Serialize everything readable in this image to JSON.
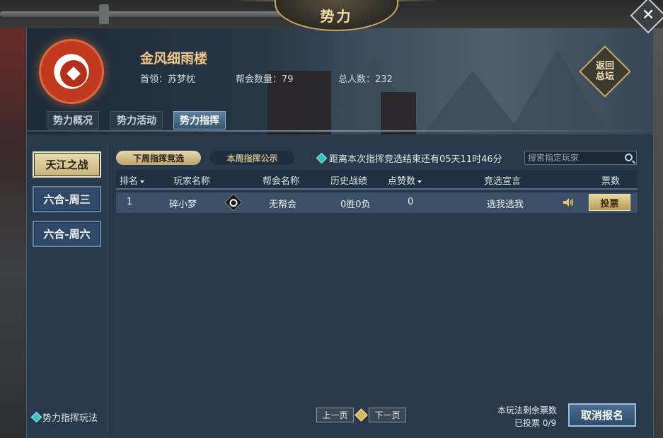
{
  "window": {
    "title": "势力",
    "close_glyph": "✕"
  },
  "faction": {
    "name": "金风细雨楼",
    "leader_label": "首领：苏梦枕",
    "guild_count_label": "帮会数量：79",
    "total_members_label": "总人数：232",
    "return_button": "返回总坛"
  },
  "main_tabs": [
    {
      "label": "势力概况",
      "active": false
    },
    {
      "label": "势力活动",
      "active": false
    },
    {
      "label": "势力指挥",
      "active": true
    }
  ],
  "sidebar": {
    "items": [
      {
        "label": "天江之战",
        "active": true
      },
      {
        "label": "六合-周三",
        "active": false
      },
      {
        "label": "六合-周六",
        "active": false
      }
    ],
    "rules_link": "势力指挥玩法"
  },
  "sub_tabs": [
    {
      "label": "下周指挥竞选",
      "active": true
    },
    {
      "label": "本周指挥公示",
      "active": false
    }
  ],
  "countdown_text": "距离本次指挥竞选结束还有05天11时46分",
  "search": {
    "placeholder": "搜索指定玩家"
  },
  "table": {
    "headers": [
      "排名",
      "玩家名称",
      "帮会名称",
      "历史战绩",
      "点赞数",
      "竞选宣言",
      "票数"
    ],
    "rows": [
      {
        "rank": "1",
        "player": "碎小梦",
        "guild": "无帮会",
        "record": "0胜0负",
        "likes": "0",
        "manifesto": "选我选我",
        "vote_button": "投票"
      }
    ]
  },
  "pagination": {
    "prev": "上一页",
    "next": "下一页"
  },
  "footer": {
    "remaining_votes_label": "本玩法剩余票数",
    "voted_label": "已投票  0/9",
    "cancel_button": "取消报名"
  },
  "colors": {
    "panel_bg": "#27394a",
    "gold_accent": "#c7a86a",
    "active_tab": "#5d7f9e",
    "emblem_red": "#c23a1e"
  }
}
